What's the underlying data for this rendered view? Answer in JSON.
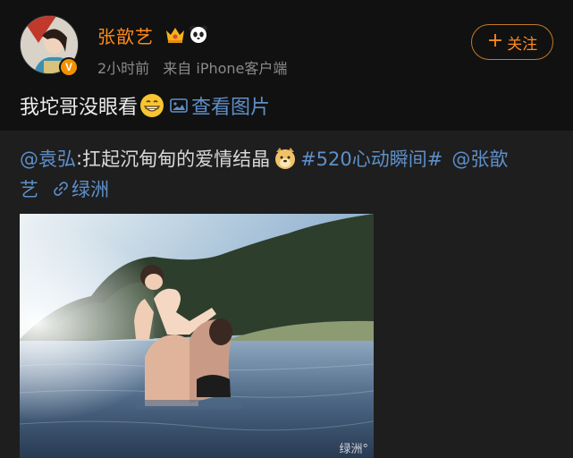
{
  "post": {
    "username": "张歆艺",
    "verified_badge": "V",
    "time": "2小时前",
    "source_prefix": "来自",
    "source": "iPhone客户端",
    "follow_label": "关注",
    "text": "我坨哥没眼看",
    "view_image_label": "查看图片",
    "icons": [
      "crown-icon",
      "panda-icon",
      "grin-emoji-icon",
      "image-icon"
    ]
  },
  "repost": {
    "mention_author": "@袁弘",
    "colon": ":",
    "text": "扛起沉甸甸的爱情结晶",
    "topic": "#520心动瞬间#",
    "mention_target_part1": "@张歆",
    "mention_target_part2": "艺",
    "location": "绿洲",
    "icons": [
      "doge-emoji-icon",
      "link-icon"
    ],
    "photo_watermark": "绿洲°"
  },
  "colors": {
    "username": "#ff8a1e",
    "link": "#5e8fc9",
    "background": "#111111",
    "repost_background": "#1e1e1e"
  }
}
